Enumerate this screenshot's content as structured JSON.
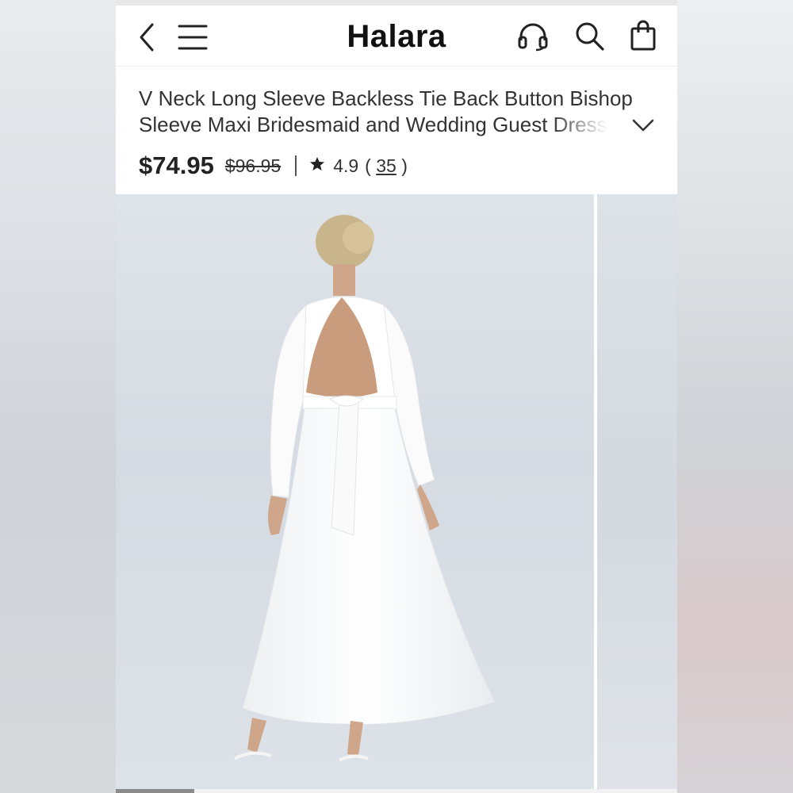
{
  "app": {
    "brand": "Halara"
  },
  "header": {
    "icons": [
      "back-icon",
      "menu-icon",
      "headset-icon",
      "search-icon",
      "shopping-bag-icon"
    ]
  },
  "product": {
    "title_line1": "V Neck Long Sleeve Backless Tie Back Button Bishop",
    "title_line2": "Sleeve Maxi Bridesmaid and Wedding Guest Dress",
    "price": "$74.95",
    "original_price": "$96.95",
    "rating": "4.9",
    "review_paren_open": "(",
    "review_count": "35",
    "review_paren_close": ")"
  },
  "gallery": {
    "image_description": "model wearing white backless maxi dress, rear view",
    "progress": 0.14
  },
  "colors": {
    "text": "#333333",
    "brand": "#111111",
    "image_bg": "#d9dfe5",
    "dress": "#ffffff"
  }
}
